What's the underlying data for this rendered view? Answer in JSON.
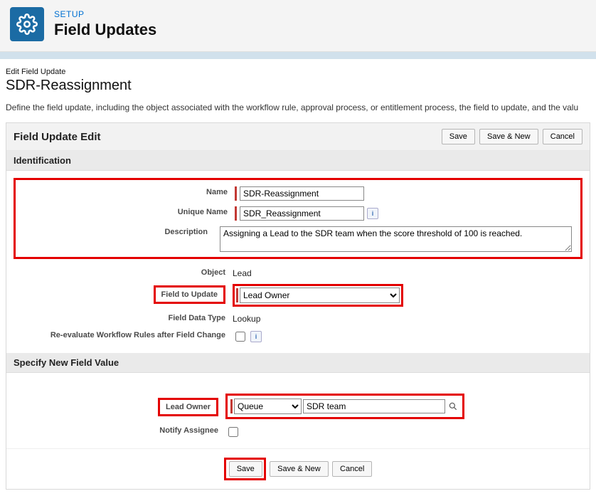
{
  "header": {
    "breadcrumb": "SETUP",
    "title": "Field Updates"
  },
  "page": {
    "editLabel": "Edit Field Update",
    "recordName": "SDR-Reassignment",
    "description": "Define the field update, including the object associated with the workflow rule, approval process, or entitlement process, the field to update, and the valu"
  },
  "panel": {
    "title": "Field Update Edit",
    "buttons": {
      "save": "Save",
      "saveNew": "Save & New",
      "cancel": "Cancel"
    }
  },
  "identification": {
    "sectionTitle": "Identification",
    "nameLabel": "Name",
    "nameValue": "SDR-Reassignment",
    "uniqueNameLabel": "Unique Name",
    "uniqueNameValue": "SDR_Reassignment",
    "descriptionLabel": "Description",
    "descriptionValue": "Assigning a Lead to the SDR team when the score threshold of 100 is reached.",
    "objectLabel": "Object",
    "objectValue": "Lead",
    "fieldToUpdateLabel": "Field to Update",
    "fieldToUpdateValue": "Lead Owner",
    "fieldDataTypeLabel": "Field Data Type",
    "fieldDataTypeValue": "Lookup",
    "reevaluateLabel": "Re-evaluate Workflow Rules after Field Change"
  },
  "newFieldValue": {
    "sectionTitle": "Specify New Field Value",
    "leadOwnerLabel": "Lead Owner",
    "ownerType": "Queue",
    "ownerValue": "SDR team",
    "notifyAssigneeLabel": "Notify Assignee"
  }
}
